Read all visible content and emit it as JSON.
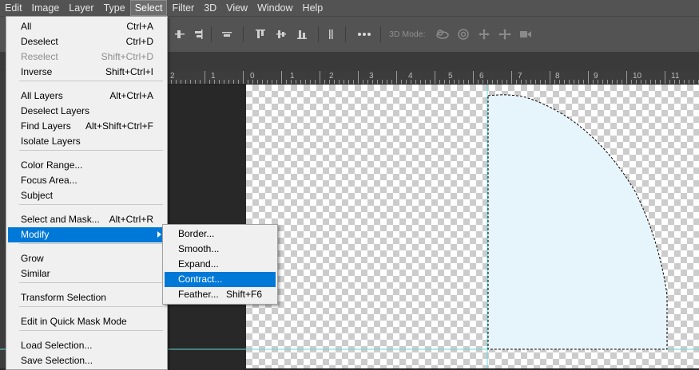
{
  "menubar": {
    "items": [
      "Edit",
      "Image",
      "Layer",
      "Type",
      "Select",
      "Filter",
      "3D",
      "View",
      "Window",
      "Help"
    ],
    "active": "Select"
  },
  "options_bar": {
    "mode_label": "3D Mode:",
    "icons": [
      "align-top-edges-icon",
      "align-vertical-centers-icon",
      "align-bottom-edges-icon",
      "align-left-edges-icon",
      "align-horizontal-centers-icon",
      "align-right-edges-icon",
      "distribute-icon",
      "more-options-icon",
      "orbit-3d-icon",
      "roll-3d-icon",
      "drag-3d-icon",
      "slide-3d-icon",
      "scale-3d-icon"
    ]
  },
  "ruler": {
    "labels": [
      "2",
      "1",
      "0",
      "1",
      "2",
      "3",
      "4",
      "5",
      "6",
      "7",
      "8",
      "9",
      "10",
      "11"
    ]
  },
  "select_menu": {
    "items": [
      {
        "label": "All",
        "shortcut": "Ctrl+A"
      },
      {
        "label": "Deselect",
        "shortcut": "Ctrl+D"
      },
      {
        "label": "Reselect",
        "shortcut": "Shift+Ctrl+D",
        "disabled": true
      },
      {
        "label": "Inverse",
        "shortcut": "Shift+Ctrl+I"
      },
      {
        "label": "All Layers",
        "shortcut": "Alt+Ctrl+A"
      },
      {
        "label": "Deselect Layers",
        "shortcut": ""
      },
      {
        "label": "Find Layers",
        "shortcut": "Alt+Shift+Ctrl+F"
      },
      {
        "label": "Isolate Layers",
        "shortcut": ""
      },
      {
        "label": "Color Range...",
        "shortcut": ""
      },
      {
        "label": "Focus Area...",
        "shortcut": ""
      },
      {
        "label": "Subject",
        "shortcut": ""
      },
      {
        "label": "Select and Mask...",
        "shortcut": "Alt+Ctrl+R"
      },
      {
        "label": "Modify",
        "shortcut": "",
        "submenu": true,
        "highlighted": true
      },
      {
        "label": "Grow",
        "shortcut": ""
      },
      {
        "label": "Similar",
        "shortcut": ""
      },
      {
        "label": "Transform Selection",
        "shortcut": ""
      },
      {
        "label": "Edit in Quick Mask Mode",
        "shortcut": ""
      },
      {
        "label": "Load Selection...",
        "shortcut": ""
      },
      {
        "label": "Save Selection...",
        "shortcut": ""
      }
    ]
  },
  "modify_submenu": {
    "items": [
      {
        "label": "Border...",
        "shortcut": ""
      },
      {
        "label": "Smooth...",
        "shortcut": ""
      },
      {
        "label": "Expand...",
        "shortcut": ""
      },
      {
        "label": "Contract...",
        "shortcut": "",
        "highlighted": true
      },
      {
        "label": "Feather...",
        "shortcut": "Shift+F6"
      }
    ]
  },
  "colors": {
    "highlight": "#0078d7",
    "menu_bg": "#f0f0f0",
    "shape_fill": "#e6f5fb",
    "guide": "#66d9d9"
  }
}
